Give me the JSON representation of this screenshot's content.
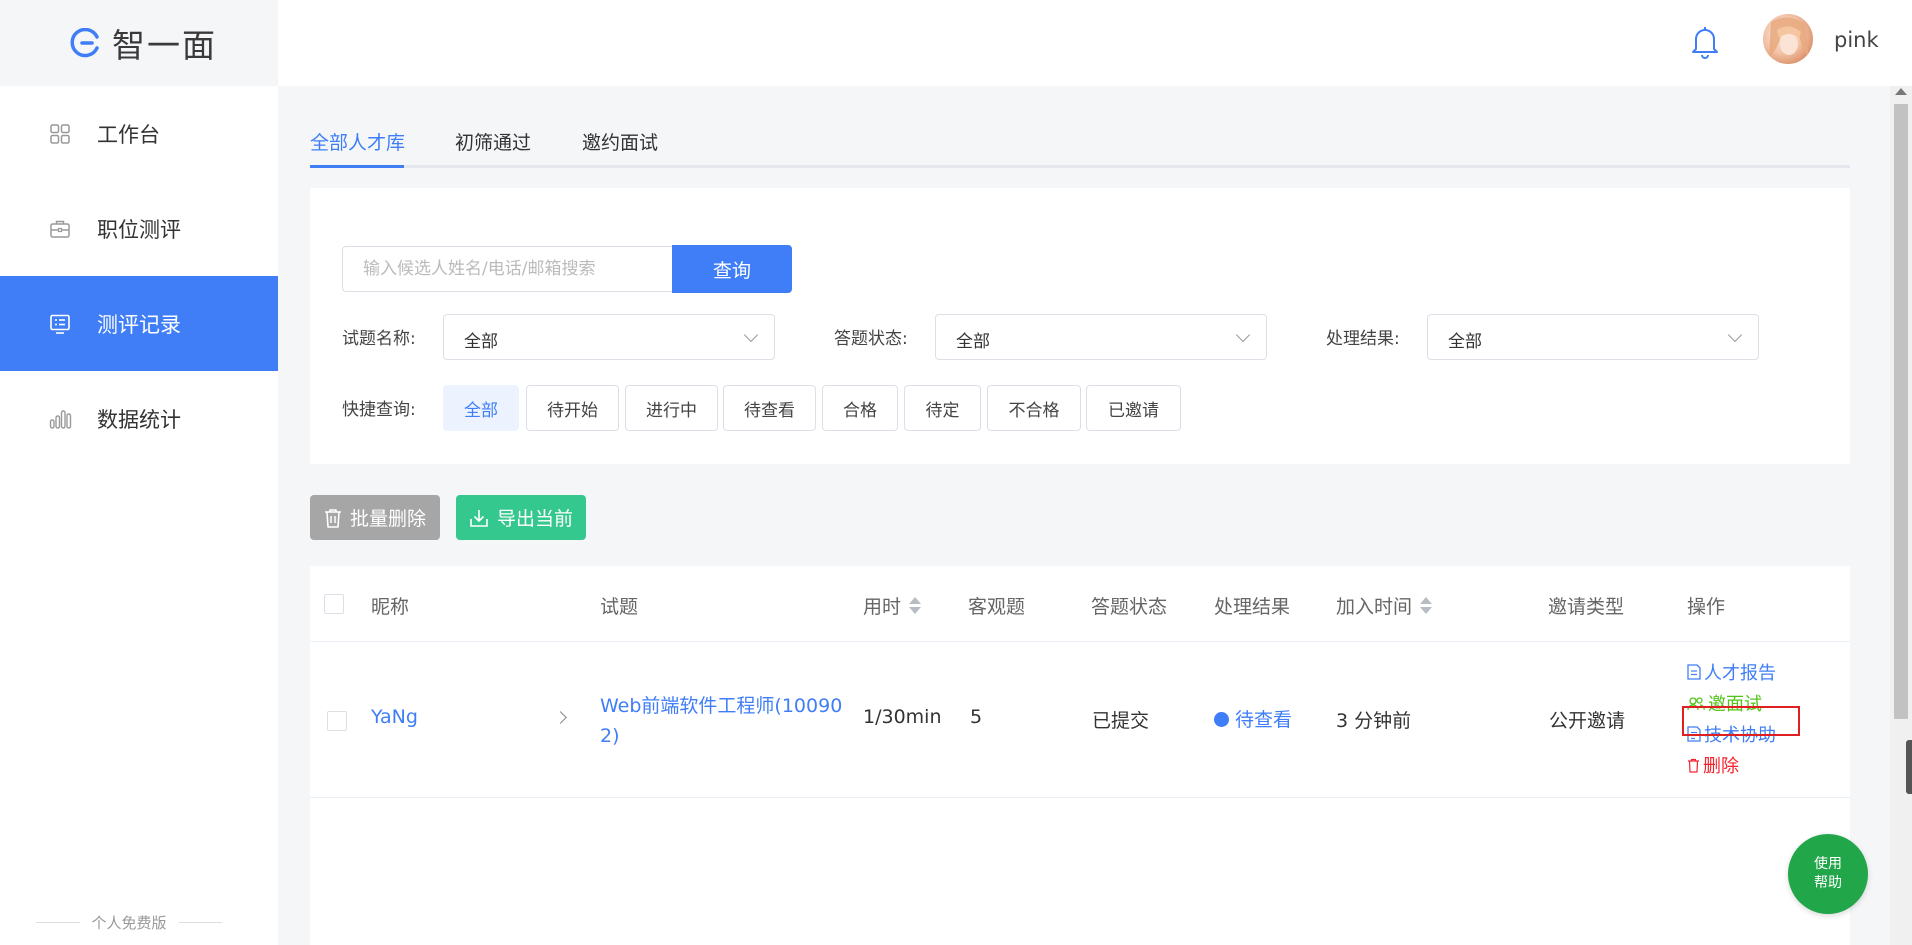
{
  "app": {
    "logo_text": "智一面"
  },
  "sidebar": {
    "items": [
      {
        "label": "工作台",
        "icon": "grid-icon",
        "active": false
      },
      {
        "label": "职位测评",
        "icon": "briefcase-icon",
        "active": false
      },
      {
        "label": "测评记录",
        "icon": "record-icon",
        "active": true
      },
      {
        "label": "数据统计",
        "icon": "bar-chart-icon",
        "active": false
      }
    ],
    "edition": "个人免费版"
  },
  "header": {
    "username": "pink"
  },
  "tabs": [
    {
      "label": "全部人才库",
      "active": true
    },
    {
      "label": "初筛通过",
      "active": false
    },
    {
      "label": "邀约面试",
      "active": false
    }
  ],
  "filters": {
    "search_placeholder": "输入候选人姓名/电话/邮箱搜索",
    "search_value": "",
    "search_button": "查询",
    "question_label": "试题名称:",
    "question_value": "全部",
    "status_label": "答题状态:",
    "status_value": "全部",
    "result_label": "处理结果:",
    "result_value": "全部",
    "quick_label": "快捷查询:",
    "quick_options": [
      "全部",
      "待开始",
      "进行中",
      "待查看",
      "合格",
      "待定",
      "不合格",
      "已邀请"
    ],
    "quick_selected": "全部"
  },
  "actions": {
    "batch_delete": "批量删除",
    "export": "导出当前"
  },
  "table": {
    "columns": [
      "昵称",
      "试题",
      "用时",
      "客观题",
      "答题状态",
      "处理结果",
      "加入时间",
      "邀请类型",
      "操作"
    ],
    "rows": [
      {
        "nickname": "YaNg",
        "question_line1": "Web前端软件工程师(10090",
        "question_line2": "2)",
        "time": "1/30min",
        "objective": "5",
        "answer_status": "已提交",
        "result": "待查看",
        "joined": "3 分钟前",
        "invite_type": "公开邀请",
        "ops": {
          "report": "人才报告",
          "invite": "邀面试",
          "assist": "技术协助",
          "delete": "删除"
        }
      }
    ]
  },
  "help": {
    "line1": "使用",
    "line2": "帮助"
  },
  "colors": {
    "primary": "#3f7ef7",
    "success": "#34c78e",
    "danger": "#f5222d",
    "help": "#21a64a"
  }
}
